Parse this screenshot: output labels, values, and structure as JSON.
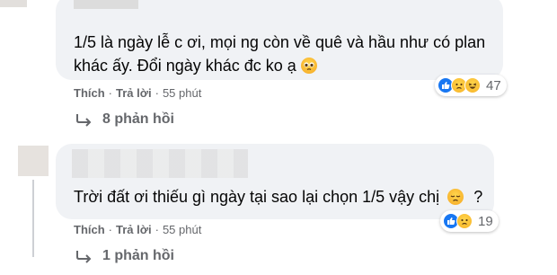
{
  "comments": [
    {
      "text_line1": "1/5 là ngày lễ c ơi, mọi ng còn về quê và hầu như có plan",
      "text_line2": "khác ấy. Đổi ngày khác đc ko ạ",
      "like_label": "Thích",
      "reply_label": "Trả lời",
      "time": "55 phút",
      "reaction_count": "47",
      "reactions": [
        "like-icon",
        "sad-icon",
        "haha-icon"
      ],
      "replies_label": "8 phản hồi",
      "emoji": "pleading-face-icon"
    },
    {
      "text_line1": "Trời đất ơi thiếu gì ngày tại sao lại chọn 1/5 vậy chị",
      "text_suffix": "?",
      "like_label": "Thích",
      "reply_label": "Trả lời",
      "time": "55 phút",
      "reaction_count": "19",
      "reactions": [
        "like-icon",
        "sad-icon"
      ],
      "replies_label": "1 phản hồi",
      "emoji": "disappointed-face-icon"
    }
  ],
  "colors": {
    "bubble": "#f0f2f5",
    "meta_text": "#65676b",
    "like_blue": "#1877f2"
  }
}
